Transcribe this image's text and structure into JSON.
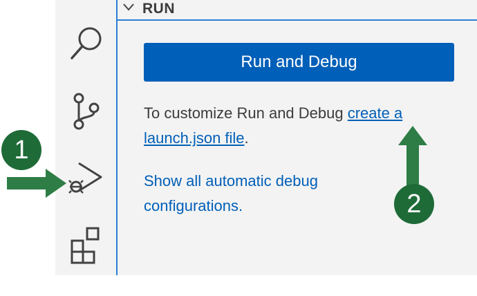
{
  "sidebar": {
    "section_title": "RUN",
    "run_button_label": "Run and Debug",
    "info_prefix": "To customize Run and Debug ",
    "info_link": "create a launch.json file",
    "info_suffix": ".",
    "show_link": "Show all automatic debug configurations."
  },
  "activity_bar": {
    "icons": [
      "search-icon",
      "source-control-icon",
      "run-debug-icon",
      "extensions-icon"
    ]
  },
  "annotations": {
    "badge_1": "1",
    "badge_2": "2",
    "color": "#2e7d46"
  },
  "colors": {
    "accent": "#005fb8",
    "focus_border": "#2b7fd4",
    "badge": "#1e6b38"
  }
}
